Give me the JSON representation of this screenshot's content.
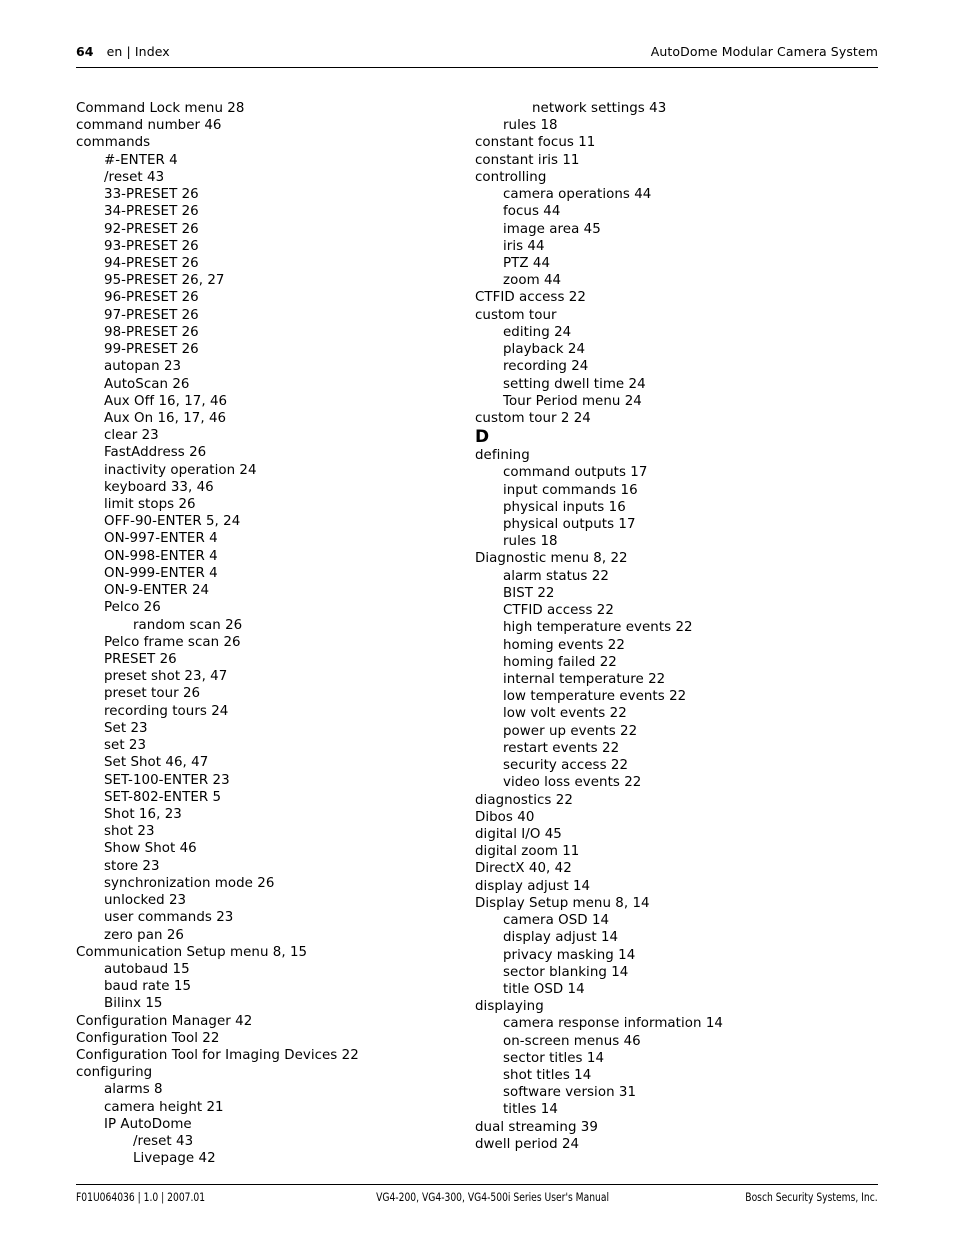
{
  "header": {
    "page_number": "64",
    "locale_section": "en | Index",
    "document_title": "AutoDome Modular Camera System"
  },
  "footer": {
    "document_id": "F01U064036 | 1.0 | 2007.01",
    "manual_title": "VG4-200, VG4-300, VG4-500i Series User's Manual",
    "publisher": "Bosch Security Systems, Inc."
  },
  "index": {
    "columns": [
      {
        "name": "left-column",
        "entries": [
          {
            "level": 0,
            "text": "Command Lock menu 28"
          },
          {
            "level": 0,
            "text": "command number 46"
          },
          {
            "level": 0,
            "text": "commands"
          },
          {
            "level": 1,
            "text": "#-ENTER 4"
          },
          {
            "level": 1,
            "text": "/reset 43"
          },
          {
            "level": 1,
            "text": "33-PRESET 26"
          },
          {
            "level": 1,
            "text": "34-PRESET 26"
          },
          {
            "level": 1,
            "text": "92-PRESET 26"
          },
          {
            "level": 1,
            "text": "93-PRESET 26"
          },
          {
            "level": 1,
            "text": "94-PRESET 26"
          },
          {
            "level": 1,
            "text": "95-PRESET 26, 27"
          },
          {
            "level": 1,
            "text": "96-PRESET 26"
          },
          {
            "level": 1,
            "text": "97-PRESET 26"
          },
          {
            "level": 1,
            "text": "98-PRESET 26"
          },
          {
            "level": 1,
            "text": "99-PRESET 26"
          },
          {
            "level": 1,
            "text": "autopan 23"
          },
          {
            "level": 1,
            "text": "AutoScan 26"
          },
          {
            "level": 1,
            "text": "Aux Off 16, 17, 46"
          },
          {
            "level": 1,
            "text": "Aux On 16, 17, 46"
          },
          {
            "level": 1,
            "text": "clear 23"
          },
          {
            "level": 1,
            "text": "FastAddress 26"
          },
          {
            "level": 1,
            "text": "inactivity operation 24"
          },
          {
            "level": 1,
            "text": "keyboard 33, 46"
          },
          {
            "level": 1,
            "text": "limit stops 26"
          },
          {
            "level": 1,
            "text": "OFF-90-ENTER 5, 24"
          },
          {
            "level": 1,
            "text": "ON-997-ENTER 4"
          },
          {
            "level": 1,
            "text": "ON-998-ENTER 4"
          },
          {
            "level": 1,
            "text": "ON-999-ENTER 4"
          },
          {
            "level": 1,
            "text": "ON-9-ENTER 24"
          },
          {
            "level": 1,
            "text": "Pelco 26"
          },
          {
            "level": 2,
            "text": "random scan 26"
          },
          {
            "level": 1,
            "text": "Pelco frame scan 26"
          },
          {
            "level": 1,
            "text": "PRESET 26"
          },
          {
            "level": 1,
            "text": "preset shot 23, 47"
          },
          {
            "level": 1,
            "text": "preset tour 26"
          },
          {
            "level": 1,
            "text": "recording tours 24"
          },
          {
            "level": 1,
            "text": "Set 23"
          },
          {
            "level": 1,
            "text": "set 23"
          },
          {
            "level": 1,
            "text": "Set Shot 46, 47"
          },
          {
            "level": 1,
            "text": "SET-100-ENTER 23"
          },
          {
            "level": 1,
            "text": "SET-802-ENTER 5"
          },
          {
            "level": 1,
            "text": "Shot 16, 23"
          },
          {
            "level": 1,
            "text": "shot 23"
          },
          {
            "level": 1,
            "text": "Show Shot 46"
          },
          {
            "level": 1,
            "text": "store 23"
          },
          {
            "level": 1,
            "text": "synchronization mode 26"
          },
          {
            "level": 1,
            "text": "unlocked 23"
          },
          {
            "level": 1,
            "text": "user commands 23"
          },
          {
            "level": 1,
            "text": "zero pan 26"
          },
          {
            "level": 0,
            "text": "Communication Setup menu 8, 15"
          },
          {
            "level": 1,
            "text": "autobaud 15"
          },
          {
            "level": 1,
            "text": "baud rate 15"
          },
          {
            "level": 1,
            "text": "Bilinx 15"
          },
          {
            "level": 0,
            "text": "Configuration Manager 42"
          },
          {
            "level": 0,
            "text": "Configuration Tool 22"
          },
          {
            "level": 0,
            "text": "Configuration Tool for Imaging Devices 22"
          },
          {
            "level": 0,
            "text": "configuring"
          },
          {
            "level": 1,
            "text": "alarms 8"
          },
          {
            "level": 1,
            "text": "camera height 21"
          },
          {
            "level": 1,
            "text": "IP AutoDome"
          },
          {
            "level": 2,
            "text": "/reset 43"
          },
          {
            "level": 2,
            "text": "Livepage 42"
          }
        ]
      },
      {
        "name": "right-column",
        "entries": [
          {
            "level": 2,
            "text": "network settings 43"
          },
          {
            "level": 1,
            "text": "rules 18"
          },
          {
            "level": 0,
            "text": "constant focus 11"
          },
          {
            "level": 0,
            "text": "constant iris 11"
          },
          {
            "level": 0,
            "text": "controlling"
          },
          {
            "level": 1,
            "text": "camera operations 44"
          },
          {
            "level": 1,
            "text": "focus 44"
          },
          {
            "level": 1,
            "text": "image area 45"
          },
          {
            "level": 1,
            "text": "iris 44"
          },
          {
            "level": 1,
            "text": "PTZ 44"
          },
          {
            "level": 1,
            "text": "zoom 44"
          },
          {
            "level": 0,
            "text": "CTFID access 22"
          },
          {
            "level": 0,
            "text": "custom tour"
          },
          {
            "level": 1,
            "text": "editing 24"
          },
          {
            "level": 1,
            "text": "playback 24"
          },
          {
            "level": 1,
            "text": "recording 24"
          },
          {
            "level": 1,
            "text": "setting dwell time 24"
          },
          {
            "level": 1,
            "text": "Tour Period menu 24"
          },
          {
            "level": 0,
            "text": "custom tour 2 24"
          },
          {
            "level": "letter",
            "text": "D"
          },
          {
            "level": 0,
            "text": "defining"
          },
          {
            "level": 1,
            "text": "command outputs 17"
          },
          {
            "level": 1,
            "text": "input commands 16"
          },
          {
            "level": 1,
            "text": "physical inputs 16"
          },
          {
            "level": 1,
            "text": "physical outputs 17"
          },
          {
            "level": 1,
            "text": "rules 18"
          },
          {
            "level": 0,
            "text": "Diagnostic menu 8, 22"
          },
          {
            "level": 1,
            "text": "alarm status 22"
          },
          {
            "level": 1,
            "text": "BIST 22"
          },
          {
            "level": 1,
            "text": "CTFID access 22"
          },
          {
            "level": 1,
            "text": "high temperature events 22"
          },
          {
            "level": 1,
            "text": "homing events 22"
          },
          {
            "level": 1,
            "text": "homing failed 22"
          },
          {
            "level": 1,
            "text": "internal temperature 22"
          },
          {
            "level": 1,
            "text": "low temperature events 22"
          },
          {
            "level": 1,
            "text": "low volt events 22"
          },
          {
            "level": 1,
            "text": "power up events 22"
          },
          {
            "level": 1,
            "text": "restart events 22"
          },
          {
            "level": 1,
            "text": "security access 22"
          },
          {
            "level": 1,
            "text": "video loss events 22"
          },
          {
            "level": 0,
            "text": "diagnostics 22"
          },
          {
            "level": 0,
            "text": "Dibos 40"
          },
          {
            "level": 0,
            "text": "digital I/O 45"
          },
          {
            "level": 0,
            "text": "digital zoom 11"
          },
          {
            "level": 0,
            "text": "DirectX 40, 42"
          },
          {
            "level": 0,
            "text": "display adjust 14"
          },
          {
            "level": 0,
            "text": "Display Setup menu 8, 14"
          },
          {
            "level": 1,
            "text": "camera OSD 14"
          },
          {
            "level": 1,
            "text": "display adjust 14"
          },
          {
            "level": 1,
            "text": "privacy masking 14"
          },
          {
            "level": 1,
            "text": "sector blanking 14"
          },
          {
            "level": 1,
            "text": "title OSD 14"
          },
          {
            "level": 0,
            "text": "displaying"
          },
          {
            "level": 1,
            "text": "camera response information 14"
          },
          {
            "level": 1,
            "text": "on-screen menus 46"
          },
          {
            "level": 1,
            "text": "sector titles 14"
          },
          {
            "level": 1,
            "text": "shot titles 14"
          },
          {
            "level": 1,
            "text": "software version 31"
          },
          {
            "level": 1,
            "text": "titles 14"
          },
          {
            "level": 0,
            "text": "dual streaming 39"
          },
          {
            "level": 0,
            "text": "dwell period 24"
          }
        ]
      }
    ]
  }
}
